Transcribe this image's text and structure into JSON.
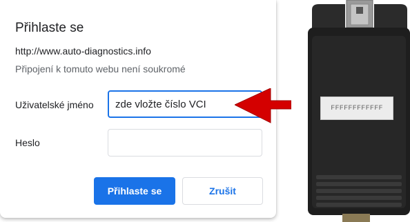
{
  "dialog": {
    "title": "Přihlaste se",
    "url": "http://www.auto-diagnostics.info",
    "privacy_note": "Připojení k tomuto webu není soukromé",
    "username_label": "Uživatelské jméno",
    "username_value": "zde vložte číslo VCI",
    "password_label": "Heslo",
    "password_value": "",
    "submit_label": "Přihlaste se",
    "cancel_label": "Zrušit"
  },
  "device": {
    "serial_label": "FFFFFFFFFFFF"
  },
  "colors": {
    "accent": "#1a73e8",
    "arrow": "#d40000",
    "device_body": "#1e1e1e"
  }
}
